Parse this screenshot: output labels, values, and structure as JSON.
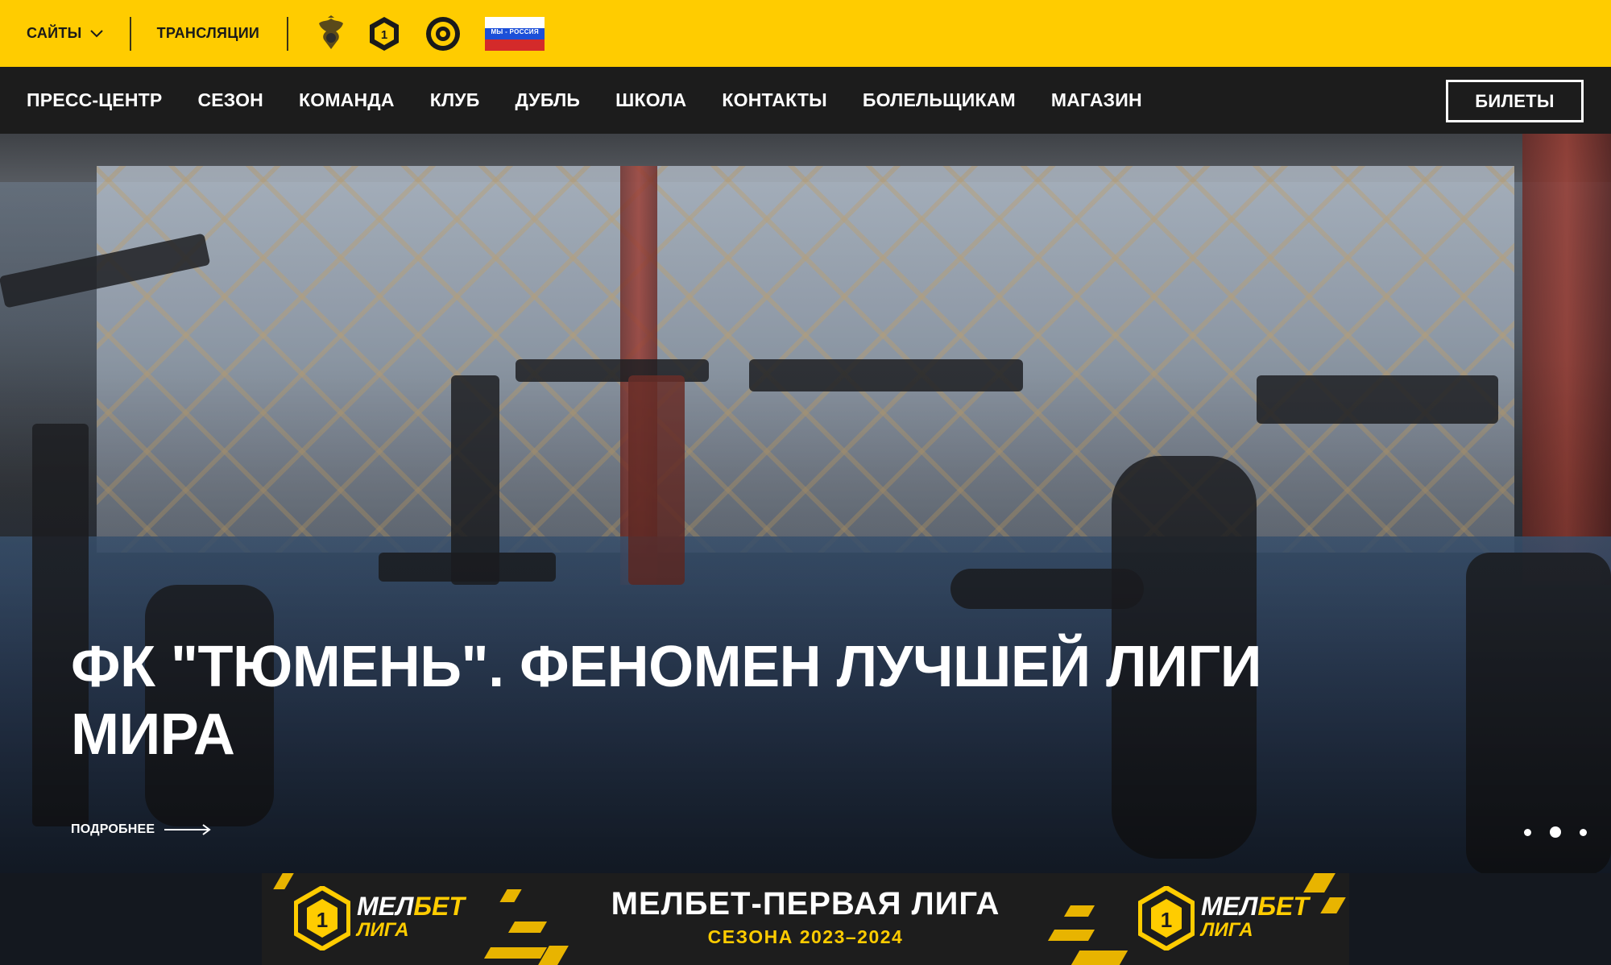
{
  "topbar": {
    "sites_label": "САЙТЫ",
    "broadcasts_label": "ТРАНСЛЯЦИИ",
    "flag_text": "МЫ - РОССИЯ",
    "background_color": "#ffcc00"
  },
  "nav": {
    "items": [
      {
        "label": "ПРЕСС-ЦЕНТР"
      },
      {
        "label": "СЕЗОН"
      },
      {
        "label": "КОМАНДА"
      },
      {
        "label": "КЛУБ"
      },
      {
        "label": "ДУБЛЬ"
      },
      {
        "label": "ШКОЛА"
      },
      {
        "label": "КОНТАКТЫ"
      },
      {
        "label": "БОЛЕЛЬЩИКАМ"
      },
      {
        "label": "МАГАЗИН"
      }
    ],
    "tickets_label": "БИЛЕТЫ"
  },
  "hero": {
    "title": "ФК \"ТЮМЕНЬ\". ФЕНОМЕН ЛУЧШЕЙ ЛИГИ МИРА",
    "more_label": "ПОДРОБНЕЕ",
    "slides_total": 3,
    "active_slide": 2
  },
  "banner": {
    "brand_word_white": "МЕЛ",
    "brand_word_yellow": "БЕТ",
    "brand_sub": "ЛИГА",
    "brand_number": "1",
    "headline": "МЕЛБЕТ-ПЕРВАЯ ЛИГА",
    "season": "СЕЗОНА 2023–2024",
    "accent_color": "#ffcc00"
  },
  "icons": [
    "chevron-down-icon",
    "rfs-emblem-icon",
    "first-league-logo-icon",
    "club-crest-icon",
    "russia-flag-icon",
    "arrow-right-icon"
  ]
}
